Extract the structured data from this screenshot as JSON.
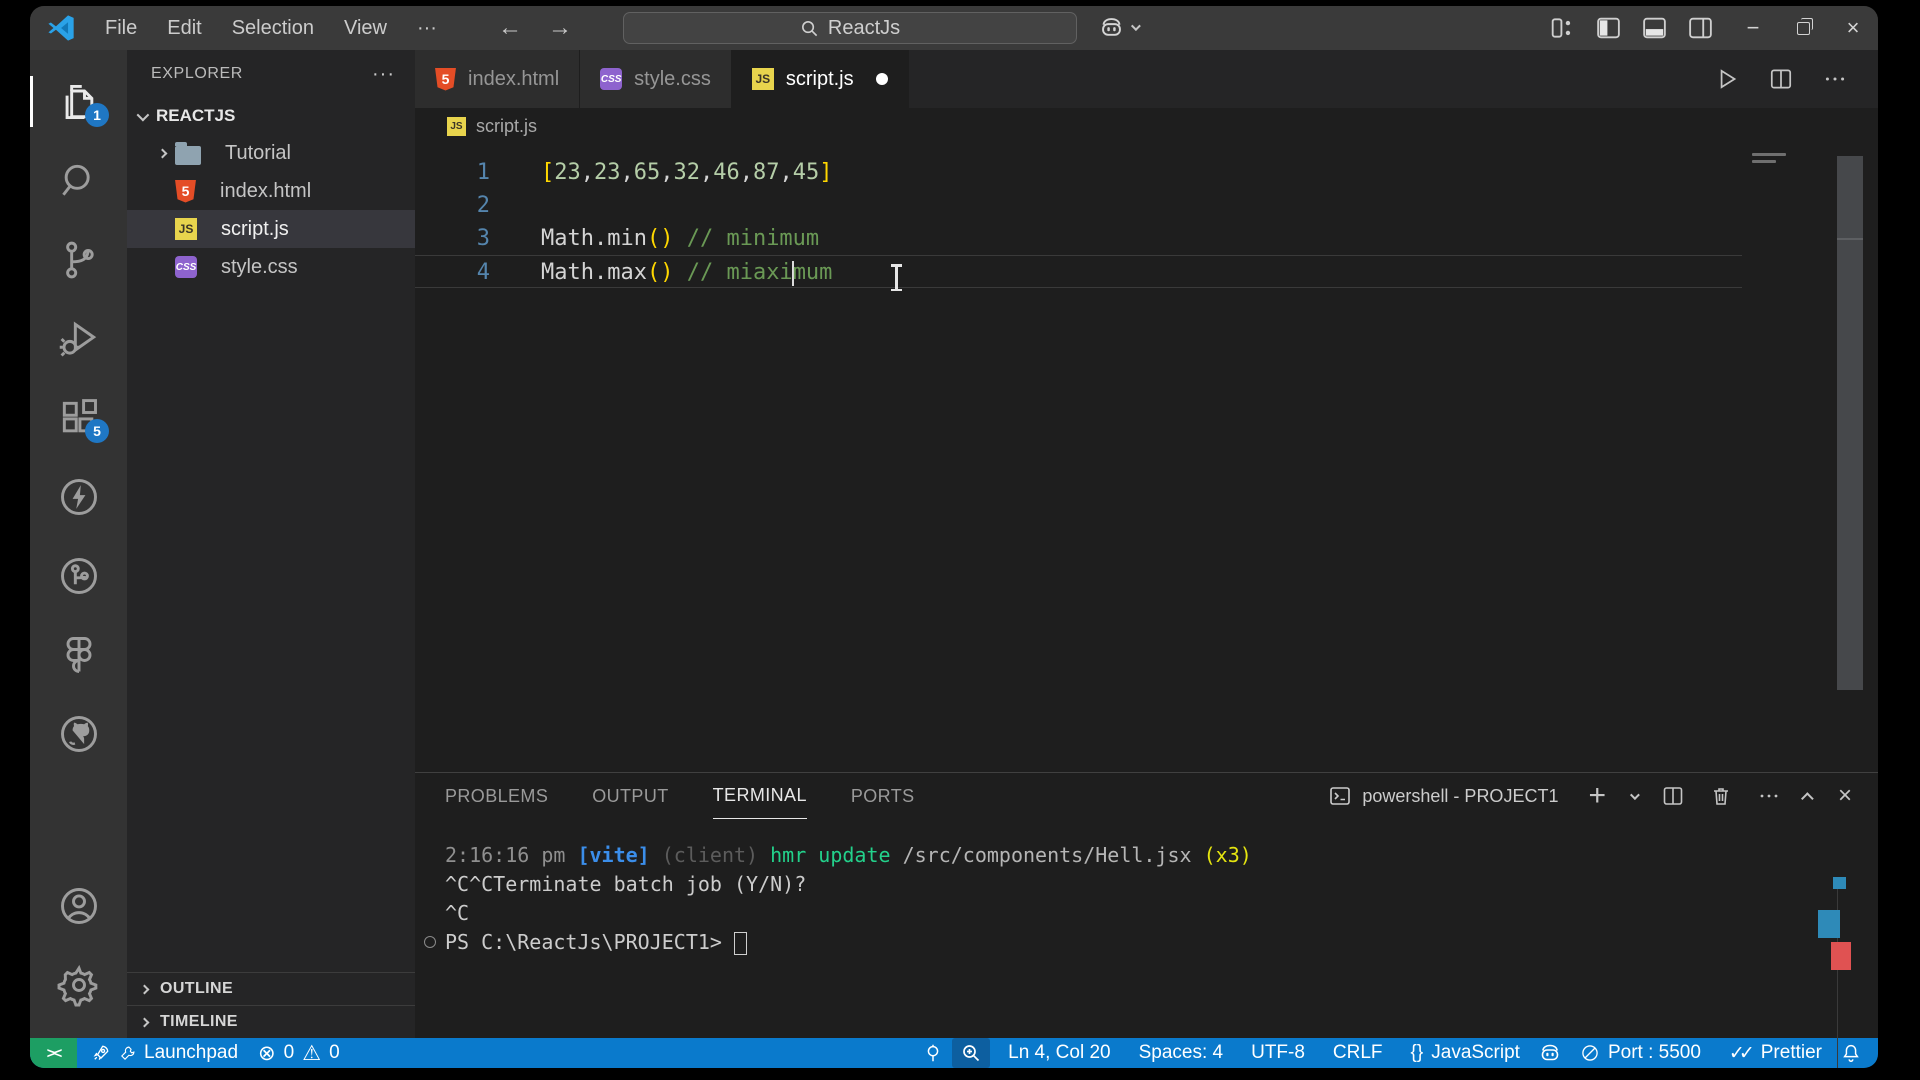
{
  "titlebar": {
    "menus": [
      "File",
      "Edit",
      "Selection",
      "View"
    ],
    "more_label": "···",
    "back": "←",
    "forward": "→",
    "search_value": "ReactJs",
    "minimize": "−",
    "close": "×"
  },
  "activity_bar": {
    "explorer_badge": "1",
    "extensions_badge": "5"
  },
  "explorer": {
    "title": "EXPLORER",
    "more_label": "···",
    "root": "REACTJS",
    "files": [
      {
        "name": "Tutorial",
        "type": "folder"
      },
      {
        "name": "index.html",
        "type": "html"
      },
      {
        "name": "script.js",
        "type": "js",
        "selected": true
      },
      {
        "name": "style.css",
        "type": "css"
      }
    ],
    "sections": [
      {
        "label": "OUTLINE"
      },
      {
        "label": "TIMELINE"
      }
    ]
  },
  "tabs": [
    {
      "label": "index.html",
      "type": "html"
    },
    {
      "label": "style.css",
      "type": "css"
    },
    {
      "label": "script.js",
      "type": "js",
      "active": true,
      "dirty": true
    }
  ],
  "editor": {
    "breadcrumb": "script.js",
    "lines": [
      {
        "num": "1",
        "segments": [
          {
            "t": "[",
            "c": "y"
          },
          {
            "t": "23",
            "c": "n"
          },
          {
            "t": ",",
            "c": "w"
          },
          {
            "t": "23",
            "c": "n"
          },
          {
            "t": ",",
            "c": "w"
          },
          {
            "t": "65",
            "c": "n"
          },
          {
            "t": ",",
            "c": "w"
          },
          {
            "t": "32",
            "c": "n"
          },
          {
            "t": ",",
            "c": "w"
          },
          {
            "t": "46",
            "c": "n"
          },
          {
            "t": ",",
            "c": "w"
          },
          {
            "t": "87",
            "c": "n"
          },
          {
            "t": ",",
            "c": "w"
          },
          {
            "t": "45",
            "c": "n"
          },
          {
            "t": "]",
            "c": "y"
          }
        ]
      },
      {
        "num": "2",
        "segments": []
      },
      {
        "num": "3",
        "segments": [
          {
            "t": "Math.min",
            "c": "w"
          },
          {
            "t": "()",
            "c": "y"
          },
          {
            "t": " ",
            "c": "w"
          },
          {
            "t": "// minimum",
            "c": "c"
          }
        ]
      },
      {
        "num": "4",
        "current": true,
        "segments": [
          {
            "t": "Math.max",
            "c": "w"
          },
          {
            "t": "()",
            "c": "y"
          },
          {
            "t": " ",
            "c": "w"
          },
          {
            "t": "// miaxi",
            "c": "c"
          },
          {
            "cursor": true
          },
          {
            "t": "mum",
            "c": "c"
          }
        ]
      }
    ]
  },
  "panel": {
    "tabs": [
      {
        "label": "PROBLEMS"
      },
      {
        "label": "OUTPUT"
      },
      {
        "label": "TERMINAL",
        "active": true
      },
      {
        "label": "PORTS"
      }
    ],
    "shell_label": "powershell - PROJECT1",
    "add_label": "+",
    "close_label": "×",
    "terminal_lines": [
      {
        "segments": [
          {
            "t": "2:16:16 pm ",
            "c": "dim"
          },
          {
            "t": "[vite]",
            "c": "blue"
          },
          {
            "t": " (client)",
            "c": "faint"
          },
          {
            "t": " ",
            "c": "fg"
          },
          {
            "t": "hmr update ",
            "c": "green"
          },
          {
            "t": "/src/components/Hell.jsx",
            "c": "gray"
          },
          {
            "t": " ",
            "c": "fg"
          },
          {
            "t": "(x3)",
            "c": "yellow"
          }
        ]
      },
      {
        "segments": [
          {
            "t": "^C^CTerminate batch job (Y/N)?",
            "c": "fg"
          }
        ]
      },
      {
        "segments": [
          {
            "t": "^C",
            "c": "fg"
          }
        ]
      },
      {
        "deco": true,
        "segments": [
          {
            "t": "PS C:\\ReactJs\\PROJECT1> ",
            "c": "fg"
          },
          {
            "cursor": true
          }
        ]
      }
    ]
  },
  "status_bar": {
    "remote_glyph": "><",
    "launchpad_label": "Launchpad",
    "errors_icon": "⊗",
    "errors": "0",
    "warnings_icon": "⚠",
    "warnings": "0",
    "line_col": "Ln 4, Col 20",
    "spaces": "Spaces: 4",
    "encoding": "UTF-8",
    "eol": "CRLF",
    "language_braces": "{}",
    "language": "JavaScript",
    "port": "Port : 5500",
    "prettier_checks": "✓✓",
    "prettier": "Prettier"
  }
}
